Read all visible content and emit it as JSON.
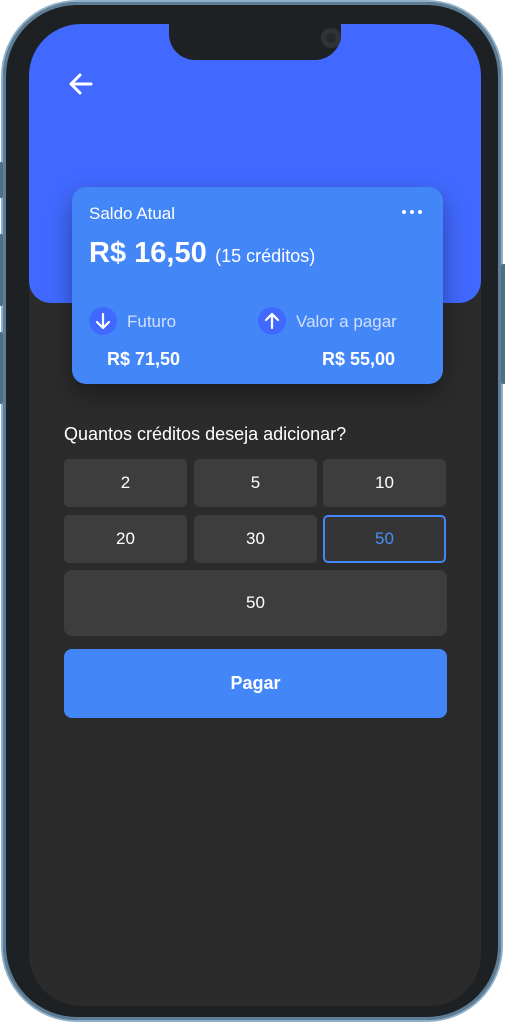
{
  "header": {
    "back_icon": "arrow-left-icon",
    "accent_color": "#4169ff"
  },
  "balance_card": {
    "title": "Saldo Atual",
    "menu_icon": "more-horizontal-icon",
    "amount": "R$ 16,50",
    "credits": "(15 créditos)",
    "future": {
      "icon": "arrow-down-icon",
      "label": "Futuro",
      "value": "R$ 71,50"
    },
    "to_pay": {
      "icon": "arrow-up-icon",
      "label": "Valor a pagar",
      "value": "R$ 55,00"
    },
    "card_color": "#4286f8"
  },
  "credits_form": {
    "question": "Quantos créditos deseja adicionar?",
    "options": [
      "2",
      "5",
      "10",
      "20",
      "30",
      "50"
    ],
    "selected_option": "50",
    "custom_value": "50",
    "pay_label": "Pagar"
  }
}
